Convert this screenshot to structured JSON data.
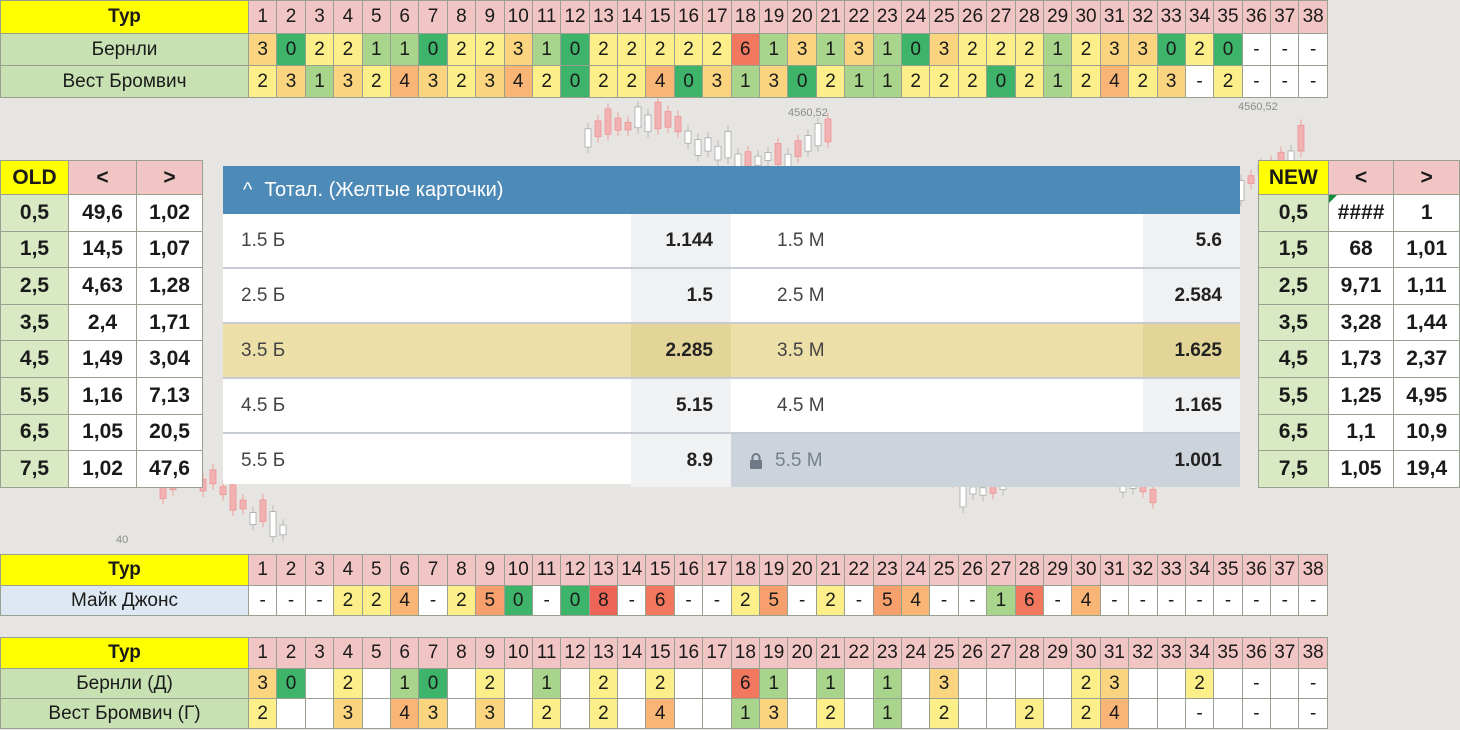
{
  "tur_label": "Тур",
  "rounds": [
    "1",
    "2",
    "3",
    "4",
    "5",
    "6",
    "7",
    "8",
    "9",
    "10",
    "11",
    "12",
    "13",
    "14",
    "15",
    "16",
    "17",
    "18",
    "19",
    "20",
    "21",
    "22",
    "23",
    "24",
    "25",
    "26",
    "27",
    "28",
    "29",
    "30",
    "31",
    "32",
    "33",
    "34",
    "35",
    "36",
    "37",
    "38"
  ],
  "top_rows": [
    {
      "name": "Бернли",
      "cells": [
        "3",
        "0",
        "2",
        "2",
        "1",
        "1",
        "0",
        "2",
        "2",
        "3",
        "1",
        "0",
        "2",
        "2",
        "2",
        "2",
        "2",
        "6",
        "1",
        "3",
        "1",
        "3",
        "1",
        "0",
        "3",
        "2",
        "2",
        "2",
        "1",
        "2",
        "3",
        "3",
        "0",
        "2",
        "0",
        "-",
        "-",
        "-"
      ]
    },
    {
      "name": "Вест Бромвич",
      "cells": [
        "2",
        "3",
        "1",
        "3",
        "2",
        "4",
        "3",
        "2",
        "3",
        "4",
        "2",
        "0",
        "2",
        "2",
        "4",
        "0",
        "3",
        "1",
        "3",
        "0",
        "2",
        "1",
        "1",
        "2",
        "2",
        "2",
        "0",
        "2",
        "1",
        "2",
        "4",
        "2",
        "3",
        "-",
        "2",
        "-",
        "-",
        "-"
      ]
    }
  ],
  "referee_row": {
    "name": "Майк Джонс",
    "cells": [
      "-",
      "-",
      "-",
      "2",
      "2",
      "4",
      "-",
      "2",
      "5",
      "0",
      "-",
      "0",
      "8",
      "-",
      "6",
      "-",
      "-",
      "2",
      "5",
      "-",
      "2",
      "-",
      "5",
      "4",
      "-",
      "-",
      "1",
      "6",
      "-",
      "4",
      "-",
      "-",
      "-",
      "-",
      "-",
      "-",
      "-",
      "-"
    ]
  },
  "split_rows": [
    {
      "name": "Бернли (Д)",
      "cells": [
        "3",
        "0",
        "",
        "2",
        "",
        "1",
        "0",
        "",
        "2",
        "",
        "1",
        "",
        "2",
        "",
        "2",
        "",
        "",
        "6",
        "1",
        "",
        "1",
        "",
        "1",
        "",
        "3",
        "",
        "",
        "",
        "",
        "2",
        "3",
        "",
        "",
        "2",
        "",
        "-",
        "",
        "-"
      ]
    },
    {
      "name": "Вест Бромвич (Г)",
      "cells": [
        "2",
        "",
        "",
        "3",
        "",
        "4",
        "3",
        "",
        "3",
        "",
        "2",
        "",
        "2",
        "",
        "4",
        "",
        "",
        "1",
        "3",
        "",
        "2",
        "",
        "1",
        "",
        "2",
        "",
        "",
        "2",
        "",
        "2",
        "4",
        "",
        "",
        "-",
        "",
        "-",
        "",
        "-"
      ]
    }
  ],
  "old_table": {
    "title": "OLD",
    "lt": "<",
    "gt": ">",
    "rows": [
      [
        "0,5",
        "49,6",
        "1,02"
      ],
      [
        "1,5",
        "14,5",
        "1,07"
      ],
      [
        "2,5",
        "4,63",
        "1,28"
      ],
      [
        "3,5",
        "2,4",
        "1,71"
      ],
      [
        "4,5",
        "1,49",
        "3,04"
      ],
      [
        "5,5",
        "1,16",
        "7,13"
      ],
      [
        "6,5",
        "1,05",
        "20,5"
      ],
      [
        "7,5",
        "1,02",
        "47,6"
      ]
    ]
  },
  "new_table": {
    "title": "NEW",
    "lt": "<",
    "gt": ">",
    "rows": [
      [
        "0,5",
        "####",
        "1"
      ],
      [
        "1,5",
        "68",
        "1,01"
      ],
      [
        "2,5",
        "9,71",
        "1,11"
      ],
      [
        "3,5",
        "3,28",
        "1,44"
      ],
      [
        "4,5",
        "1,73",
        "2,37"
      ],
      [
        "5,5",
        "1,25",
        "4,95"
      ],
      [
        "6,5",
        "1,1",
        "10,9"
      ],
      [
        "7,5",
        "1,05",
        "19,4"
      ]
    ]
  },
  "market": {
    "title": "Тотал. (Желтые карточки)",
    "chevron": "^",
    "rows": [
      {
        "over": "1.5 Б",
        "over_odds": "1.144",
        "under": "1.5 М",
        "under_odds": "5.6"
      },
      {
        "over": "2.5 Б",
        "over_odds": "1.5",
        "under": "2.5 М",
        "under_odds": "2.584"
      },
      {
        "over": "3.5 Б",
        "over_odds": "2.285",
        "under": "3.5 М",
        "under_odds": "1.625",
        "highlight": true
      },
      {
        "over": "4.5 Б",
        "over_odds": "5.15",
        "under": "4.5 М",
        "under_odds": "1.165"
      },
      {
        "over": "5.5 Б",
        "over_odds": "8.9",
        "under": "5.5 М",
        "under_odds": "1.001",
        "locked": true
      }
    ]
  },
  "background_labels": {
    "price_a": "4560,52",
    "price_b": "4560,52",
    "axis_tick": "40"
  },
  "value_colors": {
    "0": "#3eb36a",
    "1": "#a8d48b",
    "2": "#fcef89",
    "3": "#fbd480",
    "4": "#f8b575",
    "5": "#f7a06e",
    "6": "#f2775f",
    "8": "#ec6556",
    "-": "#ffffff",
    "": "#ffffff"
  }
}
